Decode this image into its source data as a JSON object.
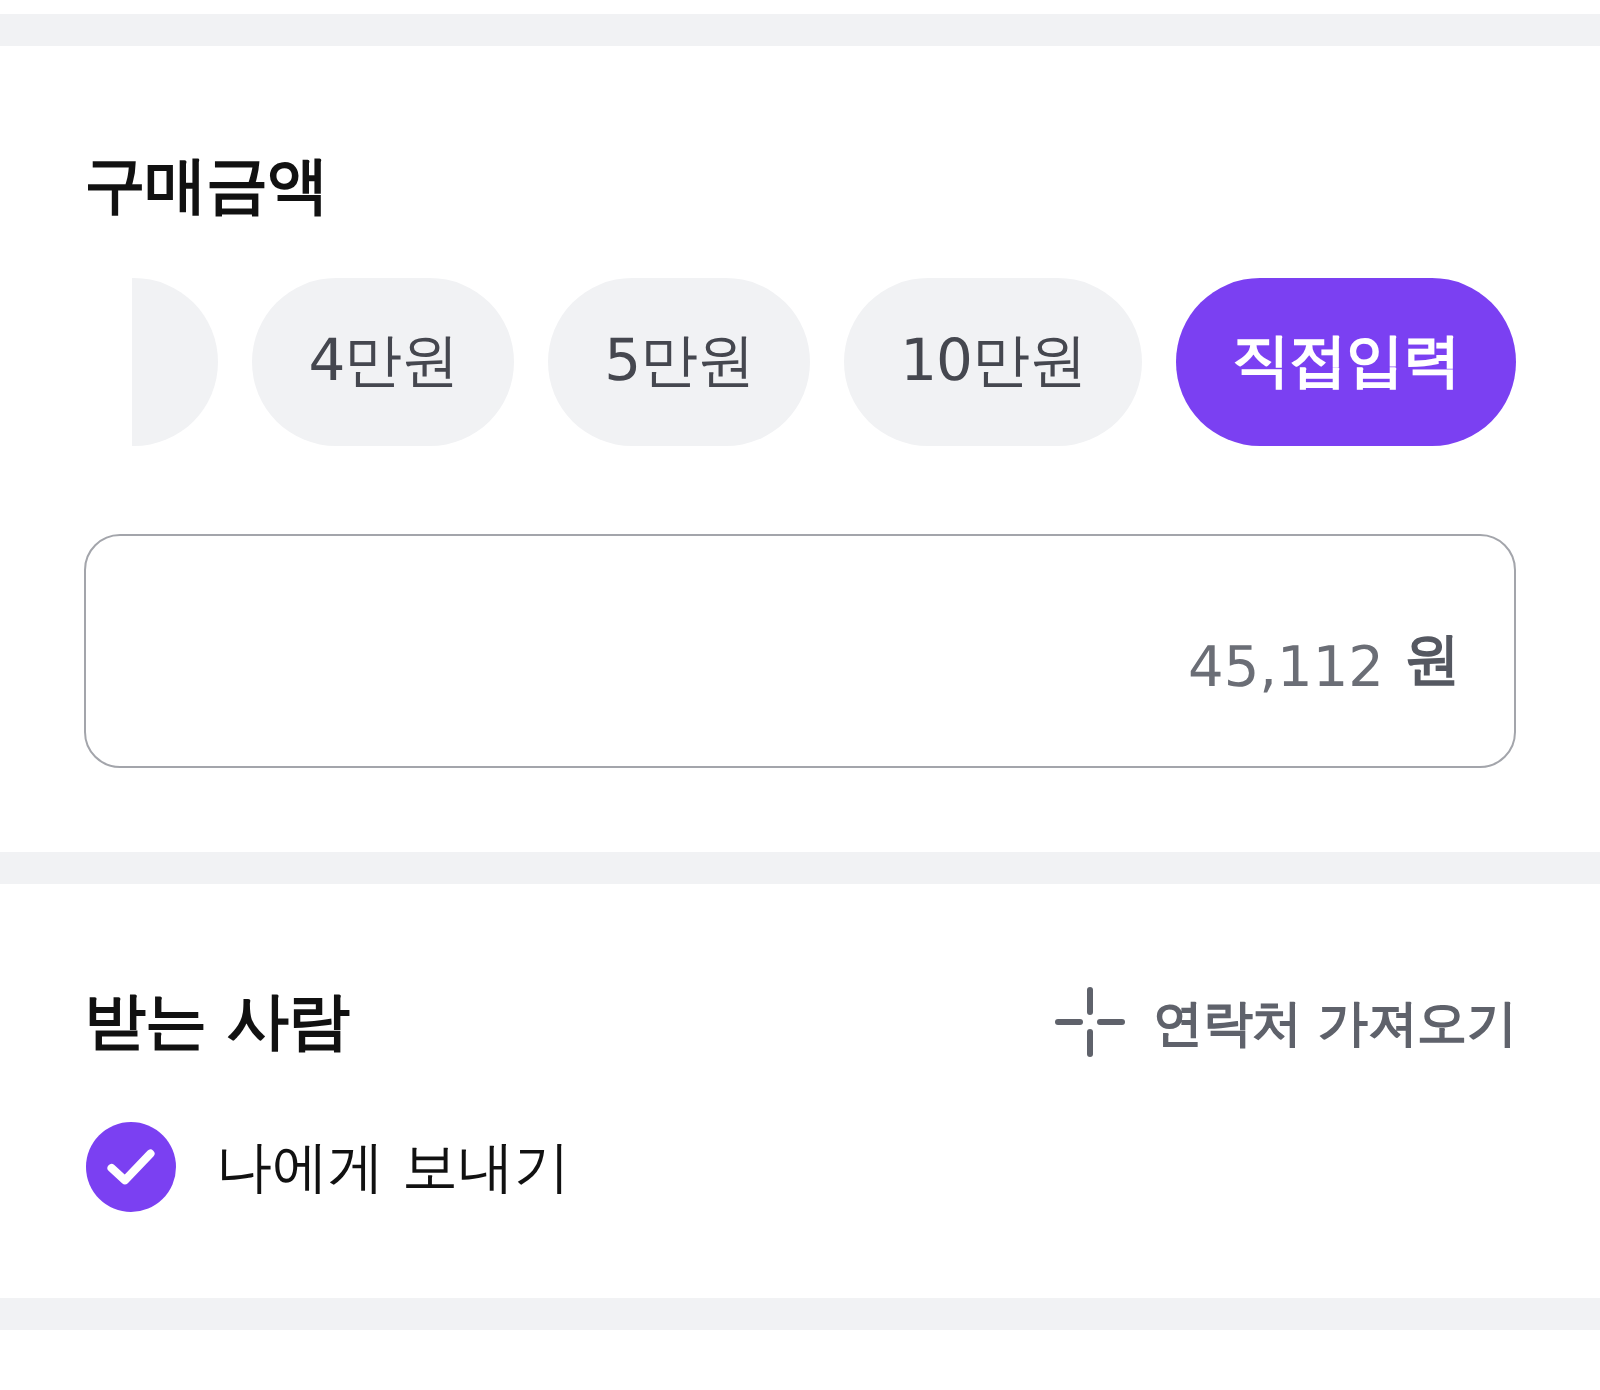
{
  "amount_section": {
    "title": "구매금액",
    "chips": [
      {
        "kind": "partial",
        "selected": false
      },
      {
        "kind": "chip",
        "label": "4만원",
        "selected": false
      },
      {
        "kind": "chip",
        "label": "5만원",
        "selected": false
      },
      {
        "kind": "chip",
        "label": "10만원",
        "selected": false
      },
      {
        "kind": "chip",
        "label": "직접입력",
        "selected": true
      }
    ],
    "amount_field": {
      "value": "45,112",
      "unit": "원"
    }
  },
  "recipient_section": {
    "title": "받는 사람",
    "import_contacts": {
      "label": "연락처 가져오기"
    },
    "send_to_me": {
      "label": "나에게 보내기",
      "checked": true
    }
  }
}
